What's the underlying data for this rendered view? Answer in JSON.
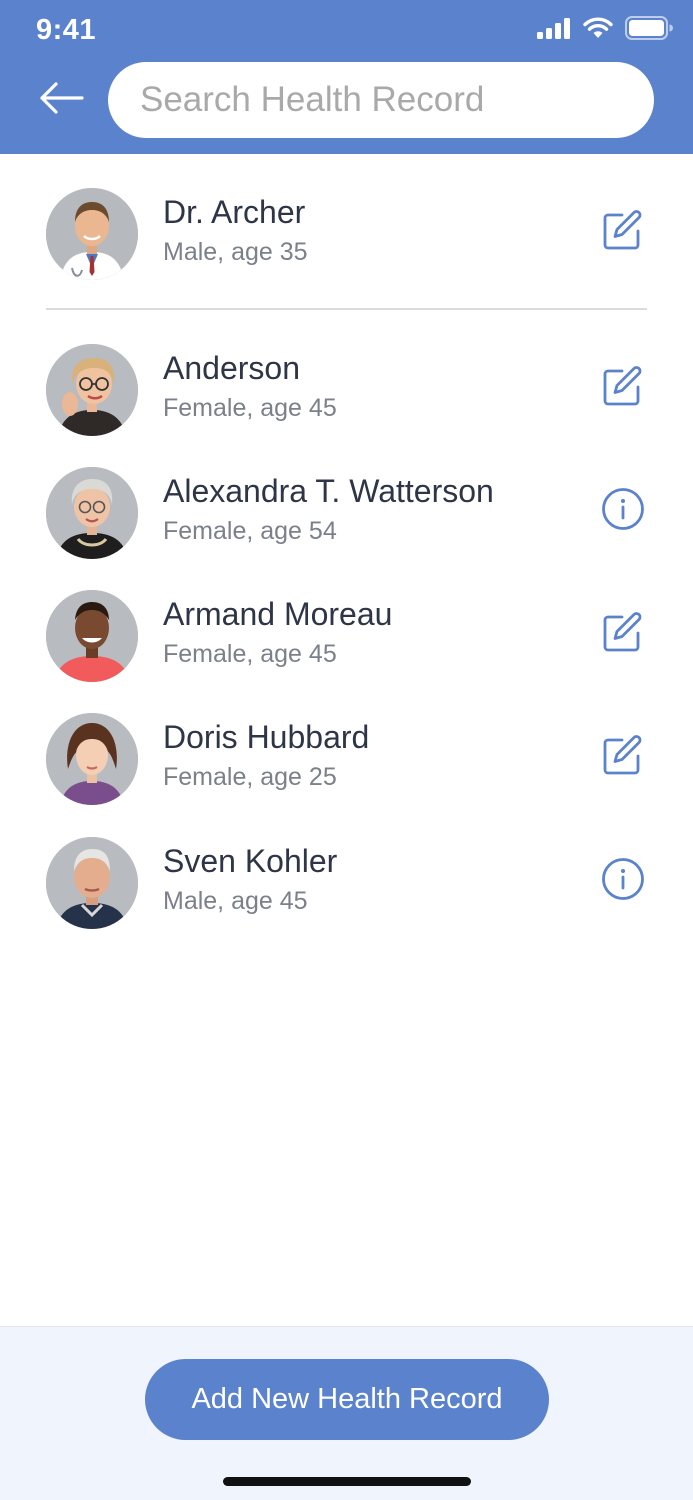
{
  "status_bar": {
    "time": "9:41",
    "icons": [
      "cellular-signal-icon",
      "wifi-icon",
      "battery-icon"
    ]
  },
  "header": {
    "back_icon": "arrow-left-icon",
    "search": {
      "placeholder": "Search Health Record",
      "value": ""
    }
  },
  "records": [
    {
      "name": "Dr. Archer",
      "detail": "Male, age 35",
      "action_icon": "edit-icon"
    },
    {
      "name": "Anderson",
      "detail": "Female, age 45",
      "action_icon": "edit-icon"
    },
    {
      "name": "Alexandra T. Watterson",
      "detail": "Female, age 54",
      "action_icon": "info-icon"
    },
    {
      "name": "Armand Moreau",
      "detail": "Female, age 45",
      "action_icon": "edit-icon"
    },
    {
      "name": "Doris Hubbard",
      "detail": "Female, age 25",
      "action_icon": "edit-icon"
    },
    {
      "name": "Sven Kohler",
      "detail": "Male, age 45",
      "action_icon": "info-icon"
    }
  ],
  "footer": {
    "add_button_label": "Add New Health Record"
  },
  "colors": {
    "primary": "#5b82cc",
    "text_primary": "#2d3546",
    "text_secondary": "#7b808a",
    "footer_bg": "#f0f4fc",
    "divider": "#d9dbde"
  }
}
